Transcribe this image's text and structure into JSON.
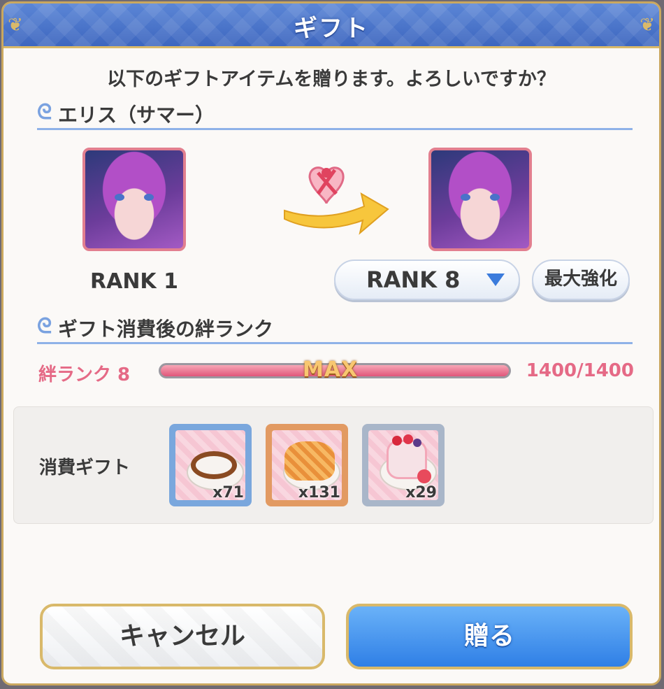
{
  "dialog": {
    "title": "ギフト",
    "question": "以下のギフトアイテムを贈ります。よろしいですか？"
  },
  "character": {
    "section_title": "エリス（サマー）",
    "current_rank": "RANK 1",
    "target_rank": "RANK 8",
    "max_enhance_label": "最大強化"
  },
  "bond": {
    "section_title": "ギフト消費後の絆ランク",
    "rank_label": "絆ランク 8",
    "bar_text": "MAX",
    "progress_text": "1400/1400",
    "progress_fraction": 1.0
  },
  "consume": {
    "label": "消費ギフト",
    "items": [
      {
        "icon": "pretzel-icon",
        "count": "x71",
        "frame_color": "#7aa7dd"
      },
      {
        "icon": "apple-pie-icon",
        "count": "x131",
        "frame_color": "#e29a62"
      },
      {
        "icon": "fruit-cake-icon",
        "count": "x29",
        "frame_color": "#a9b6c9"
      }
    ]
  },
  "buttons": {
    "cancel": "キャンセル",
    "send": "贈る"
  },
  "colors": {
    "title_bar": "#4a74c8",
    "accent_gold": "#d9b96a",
    "bond_pink": "#e56a86",
    "send_blue": "#2f7fe6"
  }
}
